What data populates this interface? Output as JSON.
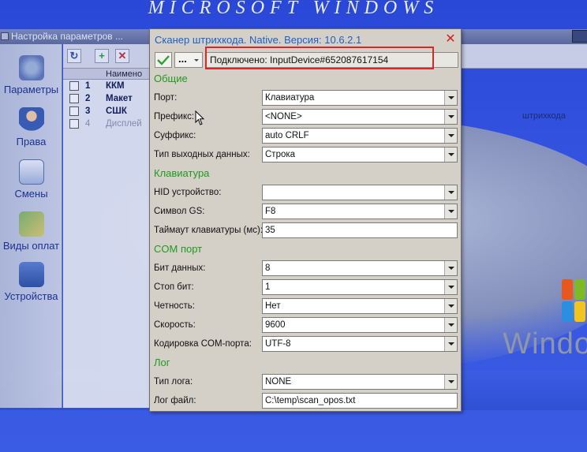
{
  "desktop": {
    "banner": "MICROSOFT   WINDOWS",
    "os_word": "Windo"
  },
  "background_window": {
    "title": "Настройка параметров ...",
    "nav": [
      "Параметры",
      "Права",
      "Смены",
      "Виды оплат",
      "Устройства"
    ],
    "list_header": "Наимено",
    "rows": [
      {
        "num": "1",
        "name": "ККМ"
      },
      {
        "num": "2",
        "name": "Макет"
      },
      {
        "num": "3",
        "name": "СШК"
      },
      {
        "num": "4",
        "name": "Дисплей"
      }
    ],
    "extra_text": "штрихкода"
  },
  "dialog": {
    "title": "Сканер штрихкода. Native. Версия: 10.6.2.1",
    "close_icon": "close-icon",
    "more_label": "...",
    "status": "Подключено: InputDevice#652087617154",
    "sections": {
      "general": "Общие",
      "keyboard": "Клавиатура",
      "com": "COM порт",
      "log": "Лог"
    },
    "fields": {
      "port": {
        "label": "Порт:",
        "value": "Клавиатура"
      },
      "prefix": {
        "label": "Префикс:",
        "value": "<NONE>"
      },
      "suffix": {
        "label": "Суффикс:",
        "value": "auto CRLF"
      },
      "output_type": {
        "label": "Тип выходных данных:",
        "value": "Строка"
      },
      "hid": {
        "label": "HID устройство:",
        "value": ""
      },
      "gs": {
        "label": "Символ GS:",
        "value": "F8"
      },
      "kbd_timeout": {
        "label": "Таймаут клавиатуры (мс):",
        "value": "35"
      },
      "data_bits": {
        "label": "Бит данных:",
        "value": "8"
      },
      "stop_bits": {
        "label": "Стоп бит:",
        "value": "1"
      },
      "parity": {
        "label": "Четность:",
        "value": "Нет"
      },
      "speed": {
        "label": "Скорость:",
        "value": "9600"
      },
      "com_encoding": {
        "label": "Кодировка COM-порта:",
        "value": "UTF-8"
      },
      "log_type": {
        "label": "Тип лога:",
        "value": "NONE"
      },
      "log_file": {
        "label": "Лог файл:",
        "value": "C:\\temp\\scan_opos.txt"
      }
    }
  },
  "colors": {
    "dialog_title": "#1d5fc9",
    "section": "#1f9a1f",
    "close": "#d62020",
    "highlight": "#d62828",
    "desktop": "#2a48d8"
  }
}
